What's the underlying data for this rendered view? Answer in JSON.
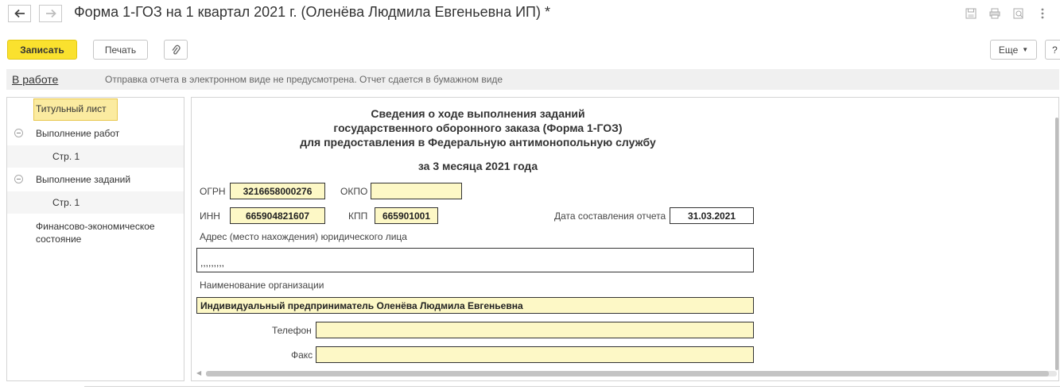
{
  "window": {
    "title": "Форма 1-ГОЗ на 1 квартал 2021 г. (Оленёва Людмила Евгеньевна ИП) *",
    "icons": [
      "back-arrow-icon",
      "forward-arrow-icon",
      "save-icon",
      "print-icon",
      "preview-icon",
      "more-vertical-icon"
    ]
  },
  "toolbar": {
    "save_label": "Записать",
    "print_label": "Печать",
    "attach_icon": "paperclip-icon",
    "more_label": "Еще",
    "help_label": "?"
  },
  "status": {
    "state_label": "В работе",
    "message": "Отправка отчета в электронном виде не предусмотрена. Отчет сдается в бумажном виде"
  },
  "tree": {
    "items": [
      {
        "label": "Титульный лист",
        "selected": true
      },
      {
        "label": "Выполнение работ",
        "collapsible": true
      },
      {
        "label": "Стр. 1"
      },
      {
        "label": "Выполнение заданий",
        "collapsible": true
      },
      {
        "label": "Стр. 1"
      },
      {
        "label": "Финансово-экономическое состояние"
      }
    ]
  },
  "form": {
    "heading_line1": "Сведения о ходе выполнения заданий",
    "heading_line2": "государственного оборонного заказа (Форма 1-ГОЗ)",
    "heading_line3": "для предоставления в Федеральную антимонопольную службу",
    "period": "за 3 месяца 2021 года",
    "ogrn_label": "ОГРН",
    "ogrn_value": "3216658000276",
    "okpo_label": "ОКПО",
    "okpo_value": "",
    "inn_label": "ИНН",
    "inn_value": "665904821607",
    "kpp_label": "КПП",
    "kpp_value": "665901001",
    "report_date_label": "Дата составления отчета",
    "report_date_value": "31.03.2021",
    "address_label": "Адрес (место нахождения) юридического лица",
    "address_value": ",,,,,,,,,",
    "org_name_label": "Наименование организации",
    "org_name_value": "Индивидуальный предприниматель Оленёва Людмила Евгеньевна",
    "phone_label": "Телефон",
    "phone_value": "",
    "fax_label": "Факс",
    "fax_value": ""
  },
  "colors": {
    "primary_button": "#fae12e",
    "field_fill": "#fdf8c6",
    "selected_item": "#fbeba0"
  }
}
